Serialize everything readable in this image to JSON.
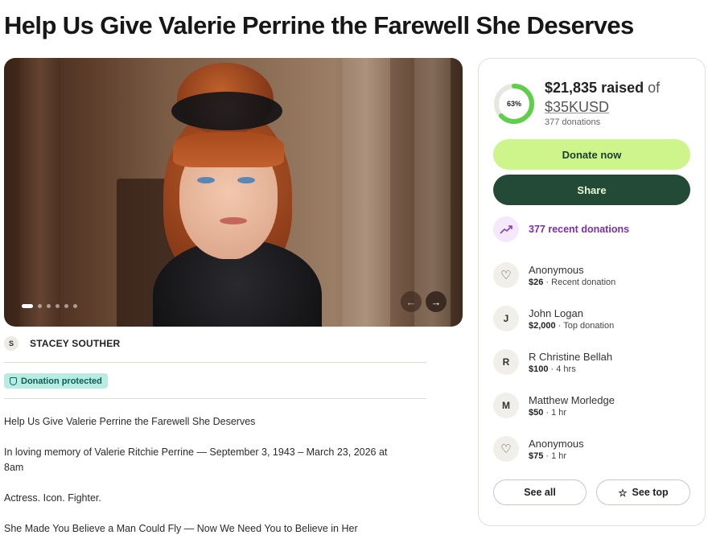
{
  "page": {
    "title": "Help Us Give Valerie Perrine the Farewell She Deserves"
  },
  "hero": {
    "image_alt": "Portrait photo",
    "slide_count": 6,
    "active_slide": 1,
    "prev_icon": "←",
    "next_icon": "→"
  },
  "organizer": {
    "initial": "S",
    "name": "STACEY SOUTHER"
  },
  "badge": {
    "label": "Donation protected"
  },
  "story": {
    "paragraphs": [
      "Help Us Give Valerie Perrine the Farewell She Deserves",
      "In loving memory of Valerie Ritchie Perrine — September 3, 1943 – March 23, 2026 at 8am",
      "Actress. Icon. Fighter.",
      "She Made You Believe a Man Could Fly — Now We Need You to Believe in Her"
    ]
  },
  "progress": {
    "percent_label": "63%",
    "percent_value": 63,
    "raised": "$21,835 raised",
    "of": " of",
    "goal": "$35KUSD",
    "donations_count": "377 donations"
  },
  "actions": {
    "donate_label": "Donate now",
    "share_label": "Share"
  },
  "recent": {
    "label": "377 recent donations",
    "icon": "trending-up-icon"
  },
  "donors": [
    {
      "avatar": "heart",
      "initial": "",
      "name": "Anonymous",
      "amount": "$26",
      "note": " · Recent donation"
    },
    {
      "avatar": "initial",
      "initial": "J",
      "name": "John Logan",
      "amount": "$2,000",
      "note": " · Top donation"
    },
    {
      "avatar": "initial",
      "initial": "R",
      "name": "R Christine Bellah",
      "amount": "$100",
      "note": " · 4 hrs"
    },
    {
      "avatar": "initial",
      "initial": "M",
      "name": "Matthew Morledge",
      "amount": "$50",
      "note": " · 1 hr"
    },
    {
      "avatar": "heart",
      "initial": "",
      "name": "Anonymous",
      "amount": "$75",
      "note": " · 1 hr"
    }
  ],
  "footer_buttons": {
    "see_all": "See all",
    "see_top": "See top",
    "see_top_icon": "☆"
  },
  "colors": {
    "donate_bg": "#cdf58c",
    "share_bg": "#234a36",
    "ring_fill": "#5fcf4b",
    "ring_track": "#e8e6e1",
    "recent_accent": "#7b2fa5",
    "badge_bg": "#b8ebe2"
  }
}
